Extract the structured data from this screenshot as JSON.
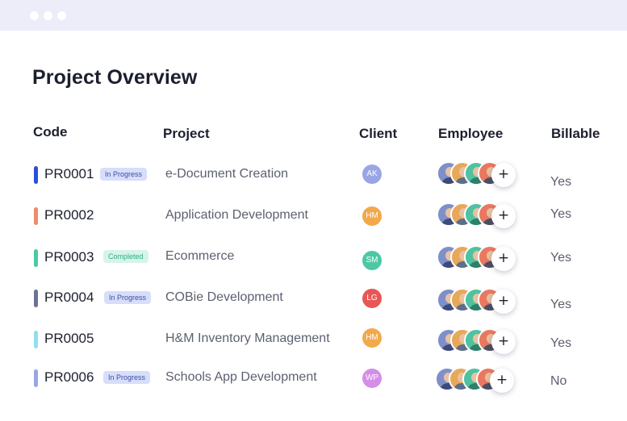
{
  "window": {
    "controls": [
      "dot",
      "dot",
      "dot"
    ]
  },
  "title": "Project Overview",
  "columns": {
    "code": "Code",
    "project": "Project",
    "client": "Client",
    "employee": "Employee",
    "billable": "Billable"
  },
  "colors": {
    "in_progress_bg": "#d7defa",
    "completed_bg": "#d6f4ea",
    "avatar_palette": [
      "#7f8fc9",
      "#e7a85a",
      "#4fc2a0",
      "#e8785f"
    ]
  },
  "rows": [
    {
      "code": "PR0001",
      "status": "In Progress",
      "status_color": "#2c4fd9",
      "project": "e-Document Creation",
      "client_initials": "AK",
      "client_color": "#9aa5e6",
      "billable": "Yes"
    },
    {
      "code": "PR0002",
      "status": "",
      "status_color": "#f08a6b",
      "project": "Application Development",
      "client_initials": "HM",
      "client_color": "#f2a94c",
      "billable": "Yes"
    },
    {
      "code": "PR0003",
      "status": "Completed",
      "status_color": "#4cc9a4",
      "project": "Ecommerce",
      "client_initials": "SM",
      "client_color": "#4cc9a4",
      "billable": "Yes"
    },
    {
      "code": "PR0004",
      "status": "In Progress",
      "status_color": "#6b7394",
      "project": "COBie Development",
      "client_initials": "LG",
      "client_color": "#e85656",
      "billable": "Yes"
    },
    {
      "code": "PR0005",
      "status": "",
      "status_color": "#8fe0ef",
      "project": "H&M Inventory Management",
      "client_initials": "HM",
      "client_color": "#f2a94c",
      "billable": "Yes"
    },
    {
      "code": "PR0006",
      "status": "In Progress",
      "status_color": "#9aa5e6",
      "project": "Schools App Development",
      "client_initials": "WP",
      "client_color": "#d48ee8",
      "billable": "No"
    }
  ],
  "add_employee_symbol": "+"
}
